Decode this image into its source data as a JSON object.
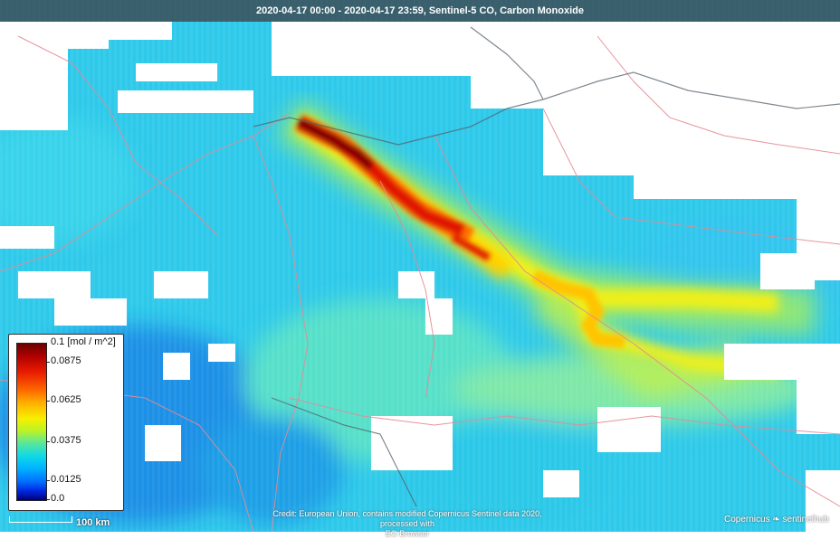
{
  "title": "2020-04-17 00:00 - 2020-04-17 23:59, Sentinel-5 CO, Carbon Monoxide",
  "legend": {
    "unit_label": "0.1 [mol / m^2]",
    "ticks": [
      "0.0875",
      "0.0625",
      "0.0375",
      "0.0125",
      "0.0"
    ]
  },
  "scale_bar": {
    "label": "100 km"
  },
  "credit": {
    "line1": "Credit: European Union, contains modified Copernicus Sentinel data 2020, processed with",
    "line2": "EO Browser"
  },
  "brand": {
    "copernicus": "Copernicus",
    "sentinelhub": "sentinelhub"
  },
  "colors": {
    "low": "#00bfff",
    "mid": "#f7f000",
    "high": "#b00000",
    "cloud_mask": "#ffffff",
    "borders": "#e89aa0"
  }
}
